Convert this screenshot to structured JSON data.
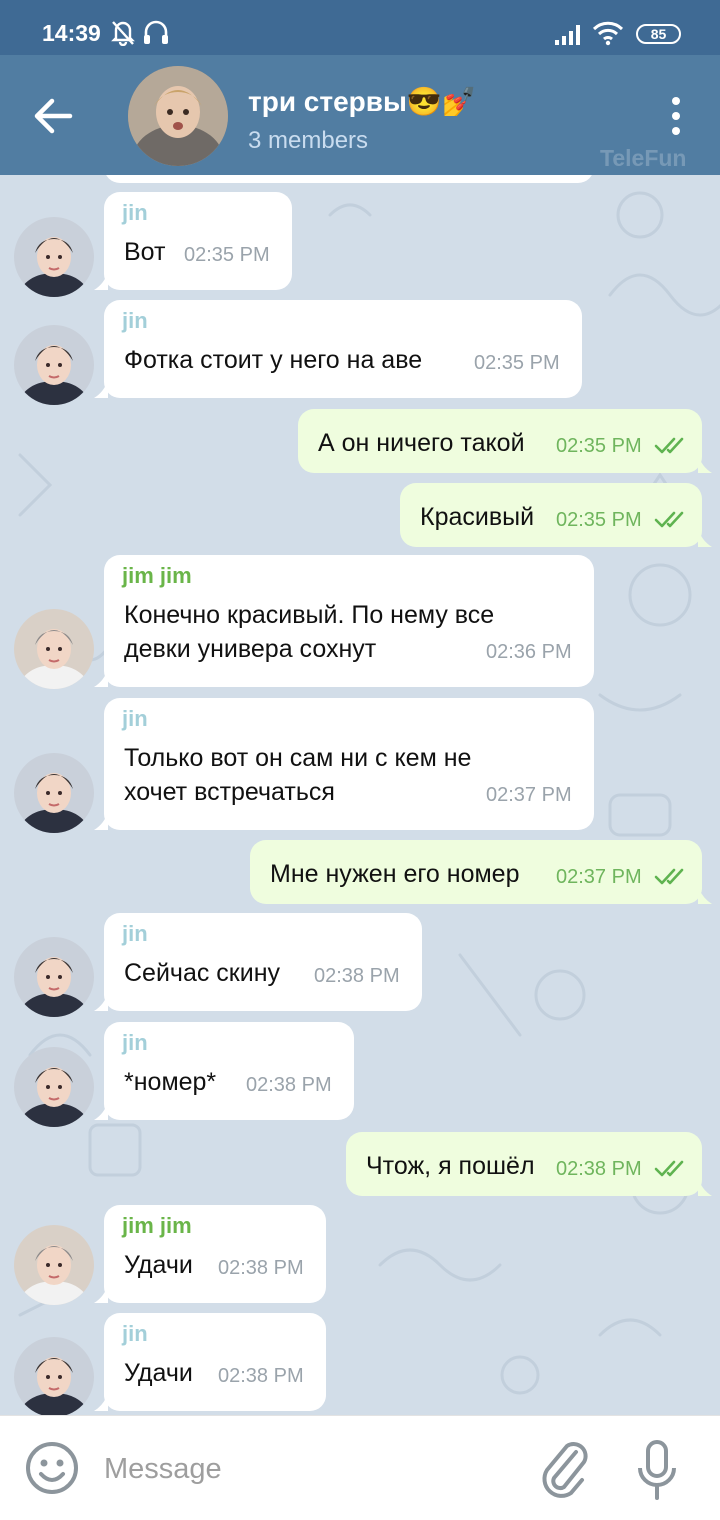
{
  "status_bar": {
    "time": "14:39",
    "battery": "85"
  },
  "header": {
    "title": "три стервы😎💅",
    "subtitle": "3 members",
    "watermark": "TeleFun"
  },
  "colors": {
    "header": "#517da2",
    "status_bar": "#3f6a94",
    "outgoing_bubble": "#effdde",
    "sender_jin": "#a3cfd9",
    "sender_jimjim": "#6ab549"
  },
  "messages": [
    {
      "sender": "jin",
      "text": [
        "Вот"
      ],
      "time": "02:35 PM"
    },
    {
      "sender": "jin",
      "text": [
        "Фотка стоит у него на аве"
      ],
      "time": "02:35 PM"
    },
    {
      "text": [
        "А он ничего такой"
      ],
      "time": "02:35 PM",
      "status_icon": "double-check-icon"
    },
    {
      "text": [
        "Красивый"
      ],
      "time": "02:35 PM",
      "status_icon": "double-check-icon"
    },
    {
      "sender": "jim jim",
      "text": [
        "Конечно красивый. По нему все",
        "девки универа сохнут"
      ],
      "time": "02:36 PM"
    },
    {
      "sender": "jin",
      "text": [
        "Только вот он сам ни с кем не",
        "хочет встречаться"
      ],
      "time": "02:37 PM"
    },
    {
      "text": [
        "Мне нужен его номер"
      ],
      "time": "02:37 PM",
      "status_icon": "double-check-icon"
    },
    {
      "sender": "jin",
      "text": [
        "Сейчас скину"
      ],
      "time": "02:38 PM"
    },
    {
      "sender": "jin",
      "text": [
        "*номер*"
      ],
      "time": "02:38 PM"
    },
    {
      "text": [
        "Чтож, я пошёл"
      ],
      "time": "02:38 PM",
      "status_icon": "double-check-icon"
    },
    {
      "sender": "jim jim",
      "text": [
        "Удачи"
      ],
      "time": "02:38 PM"
    },
    {
      "sender": "jin",
      "text": [
        "Удачи"
      ],
      "time": "02:38 PM"
    }
  ],
  "input": {
    "placeholder": "Message"
  },
  "icons": [
    "back-arrow-icon",
    "more-vertical-icon",
    "emoji-icon",
    "paperclip-icon",
    "microphone-icon",
    "double-check-icon",
    "mute-bell-icon",
    "headphones-icon",
    "signal-icon",
    "wifi-icon"
  ]
}
